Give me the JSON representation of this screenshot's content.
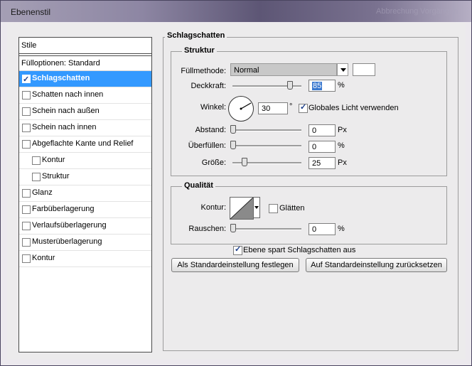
{
  "window": {
    "title": "Ebenenstil",
    "ghost_left": "Abbrechung",
    "ghost_right": "Vorgängen"
  },
  "styles": {
    "header": "Stile",
    "blending": "Fülloptionen: Standard",
    "items": [
      {
        "label": "Schlagschatten",
        "checked": true,
        "selected": true,
        "indent": 0
      },
      {
        "label": "Schatten nach innen",
        "checked": false,
        "selected": false,
        "indent": 0
      },
      {
        "label": "Schein nach außen",
        "checked": false,
        "selected": false,
        "indent": 0
      },
      {
        "label": "Schein nach innen",
        "checked": false,
        "selected": false,
        "indent": 0
      },
      {
        "label": "Abgeflachte Kante und Relief",
        "checked": false,
        "selected": false,
        "indent": 0
      },
      {
        "label": "Kontur",
        "checked": false,
        "selected": false,
        "indent": 1
      },
      {
        "label": "Struktur",
        "checked": false,
        "selected": false,
        "indent": 1
      },
      {
        "label": "Glanz",
        "checked": false,
        "selected": false,
        "indent": 0
      },
      {
        "label": "Farbüberlagerung",
        "checked": false,
        "selected": false,
        "indent": 0
      },
      {
        "label": "Verlaufsüberlagerung",
        "checked": false,
        "selected": false,
        "indent": 0
      },
      {
        "label": "Musterüberlagerung",
        "checked": false,
        "selected": false,
        "indent": 0
      },
      {
        "label": "Kontur",
        "checked": false,
        "selected": false,
        "indent": 0
      }
    ]
  },
  "panel": {
    "title": "Schlagschatten",
    "structure": {
      "title": "Struktur",
      "blend_label": "Füllmethode:",
      "blend_value": "Normal",
      "shadow_color": "#ffffff",
      "opacity_label": "Deckkraft:",
      "opacity_value": "85",
      "opacity_unit": "%",
      "opacity_fraction": 0.85,
      "angle_label": "Winkel:",
      "angle_value": "30",
      "angle_unit": "°",
      "global_light_label": "Globales Licht verwenden",
      "global_light_checked": true,
      "distance_label": "Abstand:",
      "distance_value": "0",
      "distance_unit": "Px",
      "distance_fraction": 0.0,
      "spread_label": "Überfüllen:",
      "spread_value": "0",
      "spread_unit": "%",
      "spread_fraction": 0.0,
      "size_label": "Größe:",
      "size_value": "25",
      "size_unit": "Px",
      "size_fraction": 0.17
    },
    "quality": {
      "title": "Qualität",
      "contour_label": "Kontur:",
      "antialias_label": "Glätten",
      "antialias_checked": false,
      "noise_label": "Rauschen:",
      "noise_value": "0",
      "noise_unit": "%",
      "noise_fraction": 0.0
    },
    "knockout_label": "Ebene spart Schlagschatten aus",
    "knockout_checked": true,
    "make_default_button": "Als Standardeinstellung festlegen",
    "reset_default_button": "Auf Standardeinstellung zurücksetzen"
  }
}
